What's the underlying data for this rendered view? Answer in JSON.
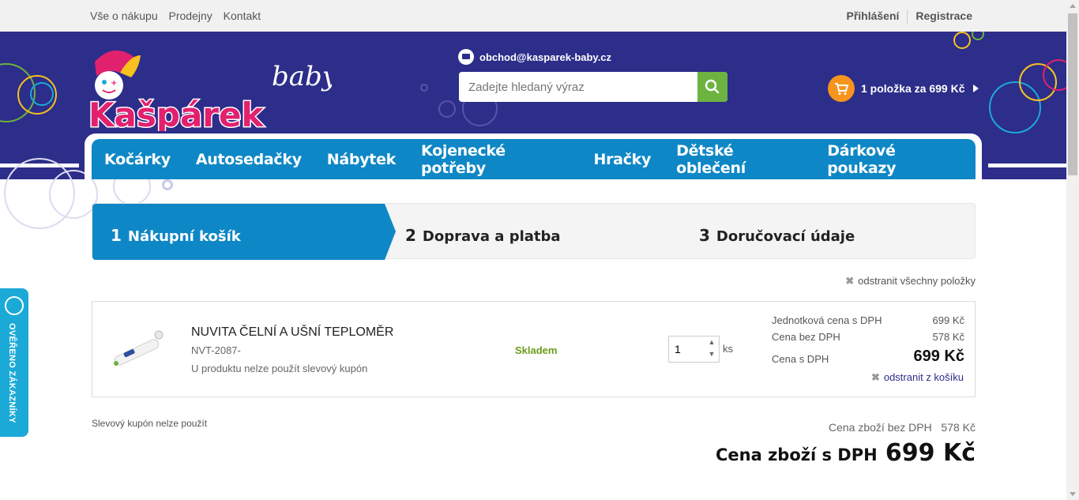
{
  "topbar": {
    "links": [
      "Vše o nákupu",
      "Prodejny",
      "Kontakt"
    ],
    "login": "Přihlášení",
    "register": "Registrace"
  },
  "header": {
    "logo_text": "Kašpárek",
    "logo_sub": "baby",
    "email": "obchod@kasparek-baby.cz",
    "search_placeholder": "Zadejte hledaný výraz",
    "cart_prefix": "1 položka za",
    "cart_price": "699 Kč"
  },
  "nav": [
    "Kočárky",
    "Autosedačky",
    "Nábytek",
    "Kojenecké potřeby",
    "Hračky",
    "Dětské oblečení",
    "Dárkové poukazy"
  ],
  "steps": [
    {
      "num": "1",
      "label": "Nákupní košík"
    },
    {
      "num": "2",
      "label": "Doprava a platba"
    },
    {
      "num": "3",
      "label": "Doručovací údaje"
    }
  ],
  "cart": {
    "remove_all": "odstranit všechny položky",
    "item": {
      "name": "NUVITA ČELNÍ A UŠNÍ TEPLOMĚR",
      "code": "NVT-2087-",
      "note": "U produktu nelze použít slevový kupón",
      "stock": "Skladem",
      "qty": "1",
      "unit": "ks",
      "unit_price_label": "Jednotková cena s DPH",
      "unit_price": "699 Kč",
      "price_net_label": "Cena bez DPH",
      "price_net": "578 Kč",
      "price_gross_label": "Cena s DPH",
      "price_gross": "699 Kč",
      "remove": "odstranit z košíku"
    },
    "coupon_note": "Slevový kupón nelze použít",
    "sum_net_label": "Cena zboží bez DPH",
    "sum_net": "578 Kč",
    "sum_gross_label": "Cena zboží s DPH",
    "sum_gross": "699 Kč"
  },
  "badge": {
    "text": "OVĚŘENO ZÁKAZNÍKY"
  },
  "colors": {
    "header": "#2d2d8a",
    "nav": "#0e87c6",
    "search_button": "#6cb33f",
    "cart": "#f7941d",
    "stock": "#6d9c1c",
    "badge": "#1ba9d8"
  }
}
